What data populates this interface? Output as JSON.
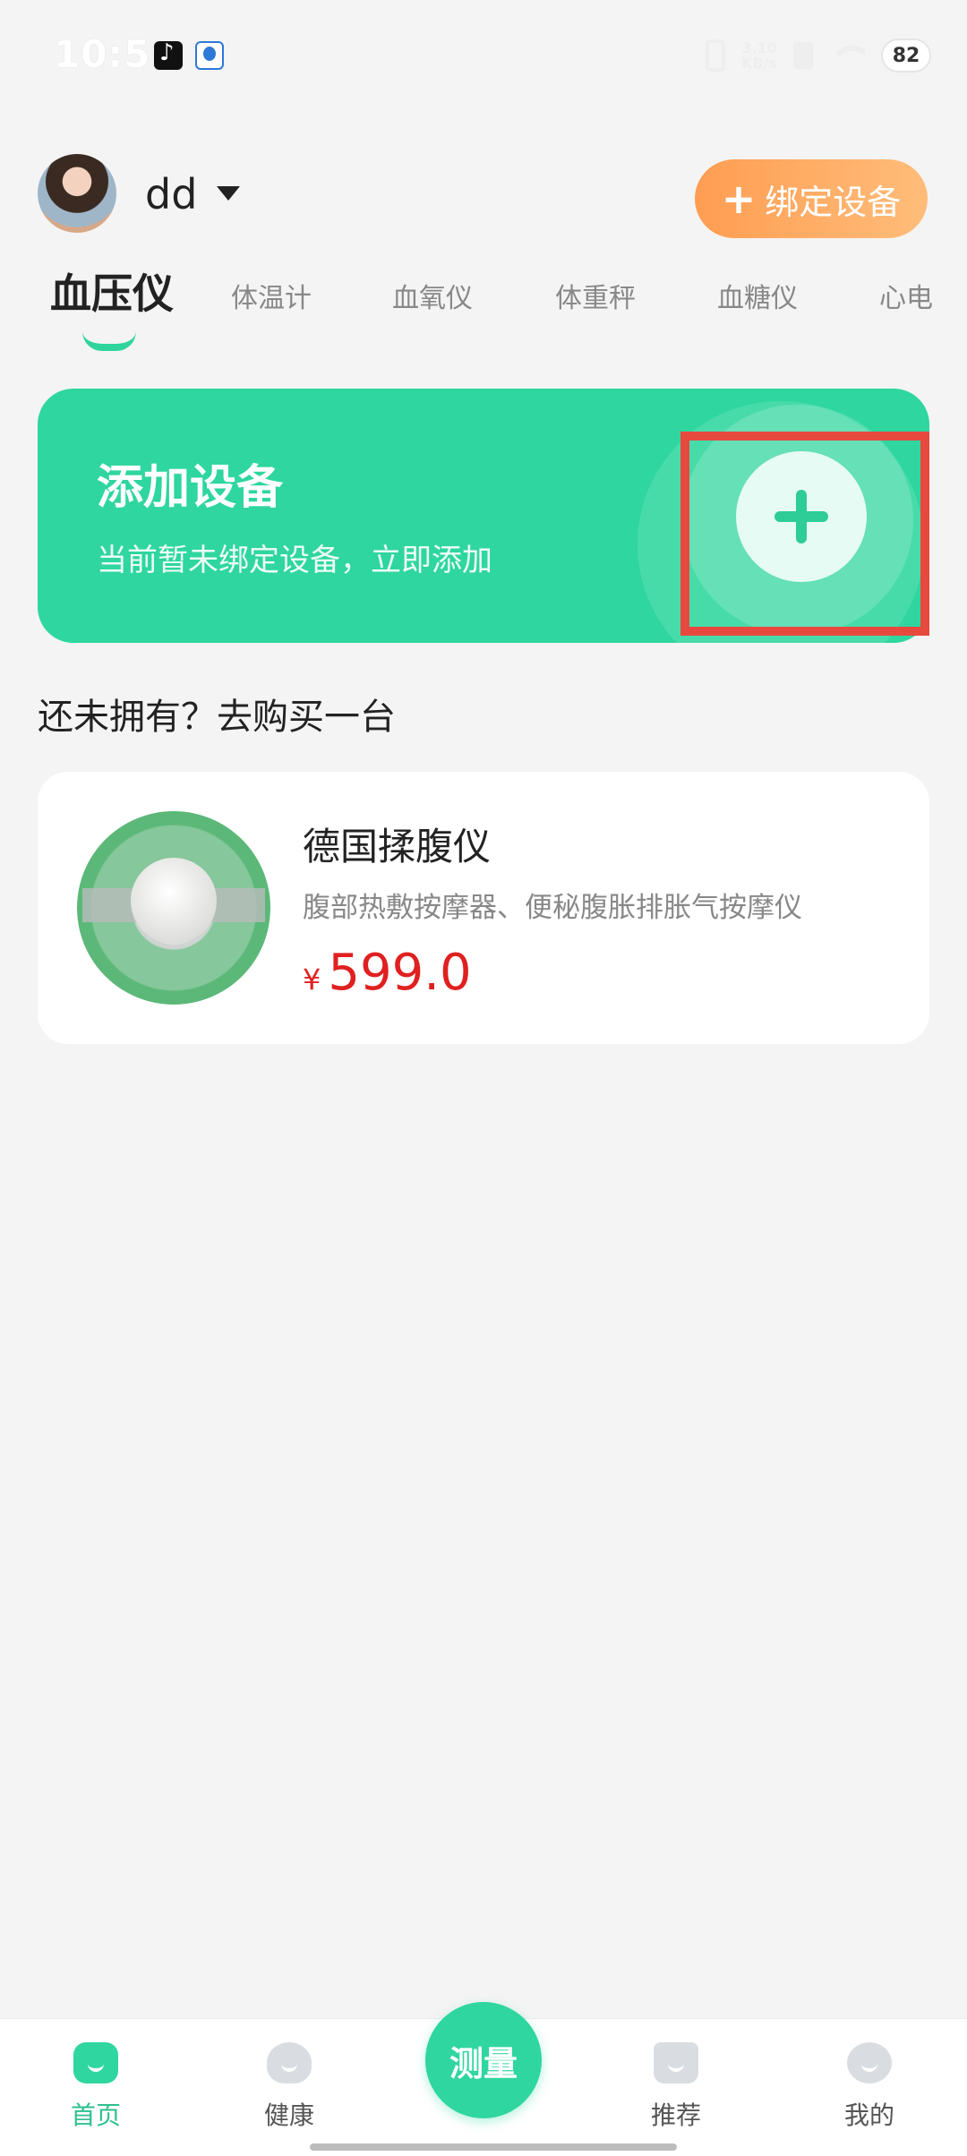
{
  "status_bar": {
    "time": "10:59",
    "net_speed_top": "3.10",
    "net_speed_bottom": "KB/s",
    "battery": "82"
  },
  "header": {
    "username": "dd",
    "bind_button_label": "绑定设备"
  },
  "tabs": [
    {
      "label": "血压仪",
      "active": true
    },
    {
      "label": "体温计",
      "active": false
    },
    {
      "label": "血氧仪",
      "active": false
    },
    {
      "label": "体重秤",
      "active": false
    },
    {
      "label": "血糖仪",
      "active": false
    },
    {
      "label": "心电",
      "active": false
    }
  ],
  "add_device_card": {
    "title": "添加设备",
    "subtitle": "当前暂未绑定设备，立即添加"
  },
  "shop": {
    "heading": "还未拥有？去购买一台",
    "products": [
      {
        "name": "德国揉腹仪",
        "description": "腹部热敷按摩器、便秘腹胀排胀气按摩仪",
        "currency": "¥",
        "price": "599.0"
      }
    ]
  },
  "bottom_nav": {
    "items": [
      {
        "label": "首页",
        "icon": "home-icon",
        "active": true
      },
      {
        "label": "健康",
        "icon": "heart-icon",
        "active": false
      },
      {
        "label": "推荐",
        "icon": "bag-icon",
        "active": false
      },
      {
        "label": "我的",
        "icon": "profile-icon",
        "active": false
      }
    ],
    "measure_label": "测量"
  },
  "colors": {
    "accent": "#2fd69f",
    "orange": "#ff9d52",
    "price_red": "#e02020",
    "highlight": "#e8493f"
  }
}
